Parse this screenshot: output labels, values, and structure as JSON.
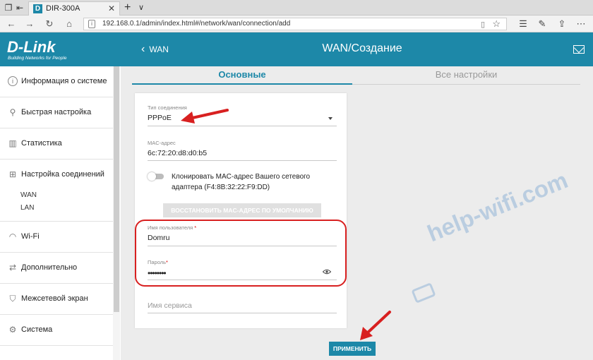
{
  "browser": {
    "tab_title": "DIR-300A",
    "tab_favicon": "D",
    "url": "192.168.0.1/admin/index.html#/network/wan/connection/add"
  },
  "header": {
    "logo": "D-Link",
    "logo_tagline": "Building Networks for People",
    "back_label": "WAN",
    "title": "WAN/Создание"
  },
  "sidebar": {
    "items": [
      {
        "label": "Информация о системе",
        "icon": "info-icon"
      },
      {
        "label": "Быстрая настройка",
        "icon": "wand-icon"
      },
      {
        "label": "Статистика",
        "icon": "stats-icon"
      },
      {
        "label": "Настройка соединений",
        "icon": "network-icon"
      },
      {
        "label": "Wi-Fi",
        "icon": "wifi-icon"
      },
      {
        "label": "Дополнительно",
        "icon": "sliders-icon"
      },
      {
        "label": "Межсетевой экран",
        "icon": "shield-icon"
      },
      {
        "label": "Система",
        "icon": "gear-icon"
      }
    ],
    "subitems": [
      "WAN",
      "LAN"
    ]
  },
  "tabs": {
    "main": "Основные",
    "all": "Все настройки"
  },
  "form": {
    "conn_type_label": "Тип соединения",
    "conn_type_value": "PPPoE",
    "mac_label": "MAC-адрес",
    "mac_value": "6c:72:20:d8:d0:b5",
    "clone_label": "Клонировать MAC-адрес Вашего сетевого адаптера (F4:8B:32:22:F9:DD)",
    "restore_button": "ВОССТАНОВИТЬ MAC-АДРЕС ПО УМОЛЧАНИЮ",
    "username_label": "Имя пользователя",
    "username_value": "Domru",
    "password_label": "Пароль",
    "password_value": "••••••••",
    "service_placeholder": "Имя сервиса",
    "required_mark": "*"
  },
  "apply_button": "ПРИМЕНИТЬ",
  "watermark": "help-wifi.com",
  "colors": {
    "accent": "#1d88a8",
    "annotation": "#d82020"
  }
}
